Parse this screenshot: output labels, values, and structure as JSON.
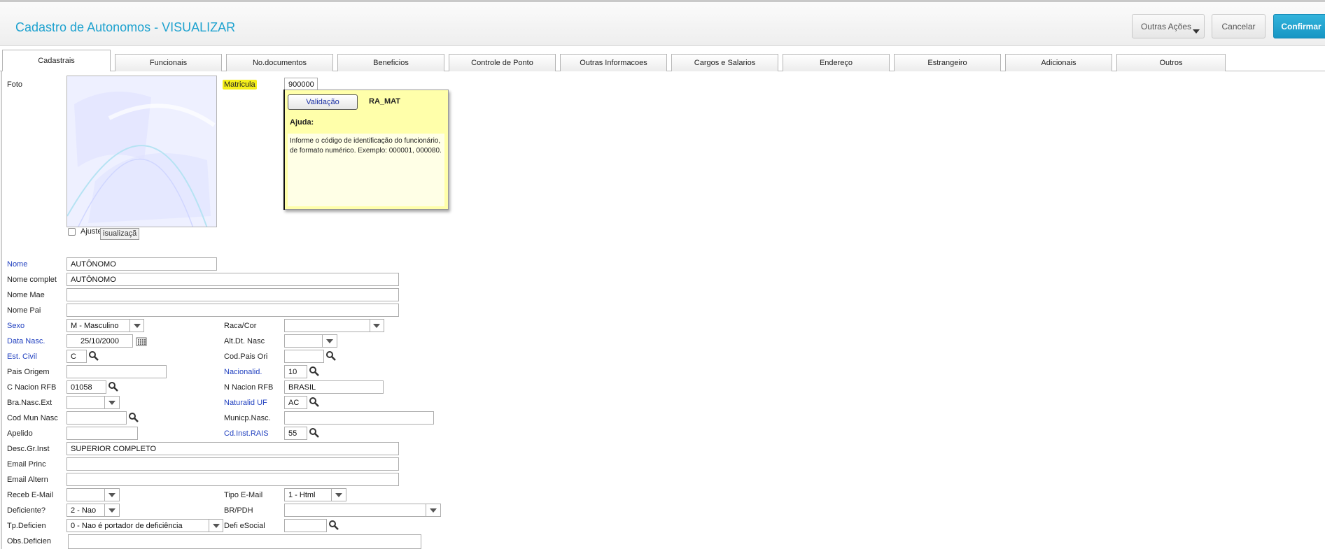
{
  "header": {
    "title": "Cadastro de Autonomos - VISUALIZAR",
    "outras_acoes": "Outras Ações",
    "cancelar": "Cancelar",
    "confirmar": "Confirmar"
  },
  "tabs": [
    "Cadastrais",
    "Funcionais",
    "No.documentos",
    "Beneficios",
    "Controle de Ponto",
    "Outras Informacoes",
    "Cargos e Salarios",
    "Endereço",
    "Estrangeiro",
    "Adicionais",
    "Outros"
  ],
  "photo": {
    "label": "Foto",
    "checkbox_label": "Ajuste",
    "tooltip": "isualizaçã"
  },
  "matricula": {
    "label": "Matricula",
    "value": "900000"
  },
  "help": {
    "validacao": "Validação",
    "code": "RA_MAT",
    "ajuda": "Ajuda:",
    "text": "Informe o código de identificação do funcionário, de formato numérico. Exemplo: 000001, 000080."
  },
  "fields": {
    "nome": {
      "label": "Nome",
      "value": "AUTÔNOMO"
    },
    "nome_complet": {
      "label": "Nome complet",
      "value": "AUTÔNOMO"
    },
    "nome_mae": {
      "label": "Nome Mae",
      "value": ""
    },
    "nome_pai": {
      "label": "Nome Pai",
      "value": ""
    },
    "sexo": {
      "label": "Sexo",
      "value": "M - Masculino"
    },
    "raca_cor": {
      "label": "Raca/Cor",
      "value": ""
    },
    "data_nasc": {
      "label": "Data Nasc.",
      "value": "25/10/2000"
    },
    "alt_dt_nasc": {
      "label": "Alt.Dt. Nasc",
      "value": ""
    },
    "est_civil": {
      "label": "Est. Civil",
      "value": "C"
    },
    "cod_pais_ori": {
      "label": "Cod.Pais Ori",
      "value": ""
    },
    "pais_origem": {
      "label": "Pais Origem",
      "value": ""
    },
    "nacionalid": {
      "label": "Nacionalid.",
      "value": "10"
    },
    "c_nacion_rfb": {
      "label": "C Nacion RFB",
      "value": "01058"
    },
    "n_nacion_rfb": {
      "label": "N Nacion RFB",
      "value": "BRASIL"
    },
    "bra_nasc_ext": {
      "label": "Bra.Nasc.Ext",
      "value": ""
    },
    "naturalid_uf": {
      "label": "Naturalid UF",
      "value": "AC"
    },
    "cod_mun_nasc": {
      "label": "Cod Mun Nasc",
      "value": ""
    },
    "municp_nasc": {
      "label": "Municp.Nasc.",
      "value": ""
    },
    "apelido": {
      "label": "Apelido",
      "value": ""
    },
    "cd_inst_rais": {
      "label": "Cd.Inst.RAIS",
      "value": "55"
    },
    "desc_gr_inst": {
      "label": "Desc.Gr.Inst",
      "value": "SUPERIOR COMPLETO"
    },
    "email_princ": {
      "label": "Email Princ",
      "value": ""
    },
    "email_altern": {
      "label": "Email Altern",
      "value": ""
    },
    "receb_email": {
      "label": "Receb E-Mail",
      "value": ""
    },
    "tipo_email": {
      "label": "Tipo E-Mail",
      "value": "1 - Html"
    },
    "deficiente": {
      "label": "Deficiente?",
      "value": "2 - Nao"
    },
    "br_pdh": {
      "label": "BR/PDH",
      "value": ""
    },
    "tp_deficien": {
      "label": "Tp.Deficien",
      "value": "0 - Nao é portador de deficiência"
    },
    "defi_esocial": {
      "label": "Defi eSocial",
      "value": ""
    },
    "obs_deficien": {
      "label": "Obs.Deficien",
      "value": ""
    }
  }
}
